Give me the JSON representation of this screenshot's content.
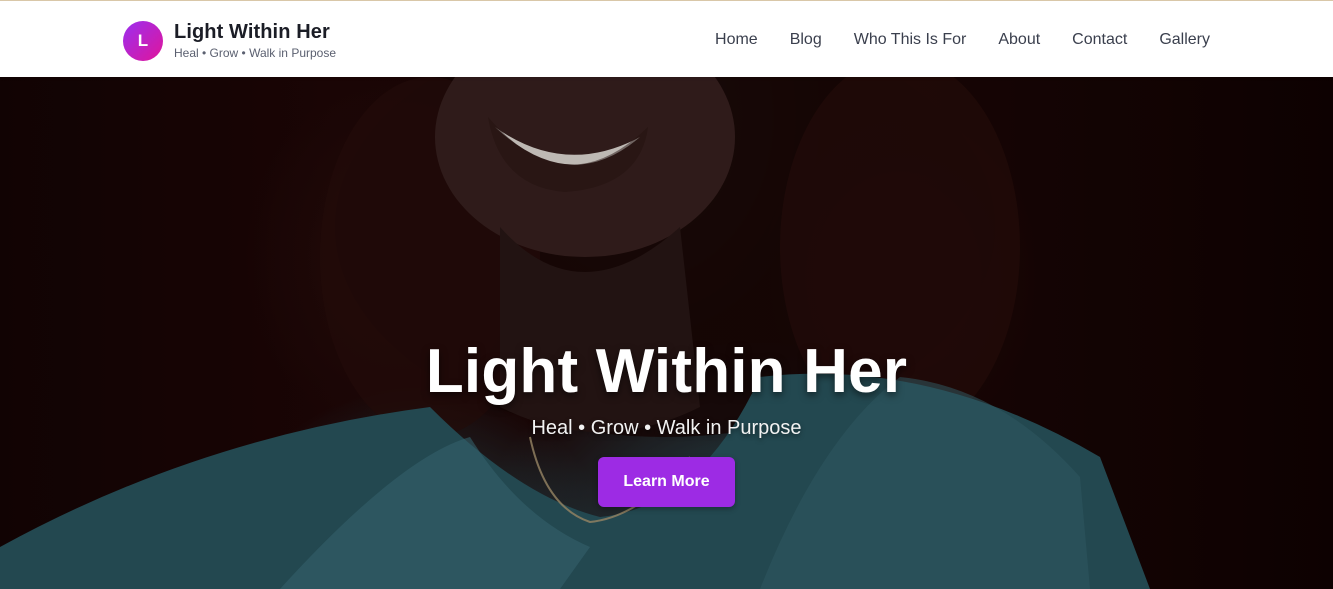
{
  "header": {
    "logo_letter": "L",
    "brand_title": "Light Within Her",
    "brand_tagline": "Heal • Grow • Walk in Purpose",
    "nav": [
      "Home",
      "Blog",
      "Who This Is For",
      "About",
      "Contact",
      "Gallery"
    ]
  },
  "hero": {
    "title": "Light Within Her",
    "subtitle": "Heal • Grow • Walk in Purpose",
    "cta_label": "Learn More",
    "image_description": "hero-photo"
  },
  "colors": {
    "accent": "#9d2be4",
    "logo_gradient_start": "#9b2ff0",
    "logo_gradient_end": "#e0159a",
    "header_bg": "#ffffff",
    "nav_text": "#3a3f4d"
  }
}
